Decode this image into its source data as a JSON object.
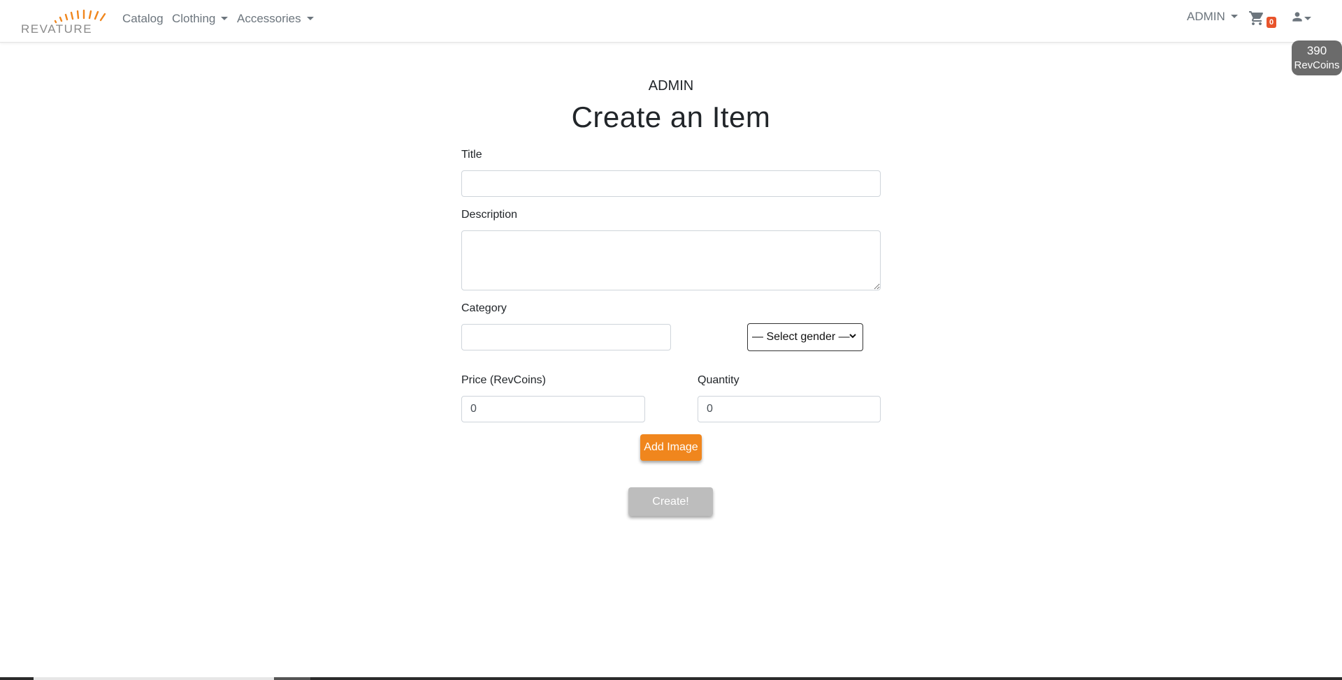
{
  "brand": {
    "name": "REVATURE",
    "accent": "#f0861d"
  },
  "nav": {
    "catalog": "Catalog",
    "clothing": "Clothing",
    "accessories": "Accessories",
    "admin": "ADMIN",
    "cart_count": "0",
    "cart_icon": "cart-icon",
    "user_icon": "user-icon"
  },
  "coins": {
    "amount": "390",
    "unit": "RevCoins"
  },
  "page": {
    "subheading": "ADMIN",
    "heading": "Create an Item"
  },
  "form": {
    "title_label": "Title",
    "title_value": "",
    "description_label": "Description",
    "description_value": "",
    "category_label": "Category",
    "category_value": "",
    "gender_select": "— Select gender —",
    "price_label": "Price (RevCoins)",
    "price_value": "0",
    "quantity_label": "Quantity",
    "quantity_value": "0",
    "add_image_label": "Add Image",
    "create_label": "Create!"
  }
}
